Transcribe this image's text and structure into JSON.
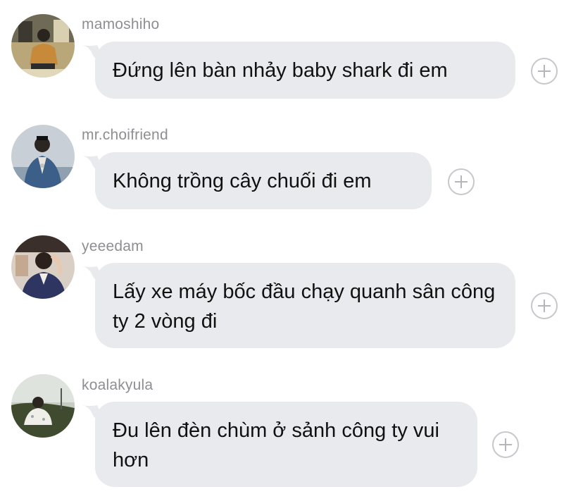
{
  "messages": [
    {
      "username": "mamoshiho",
      "text": "Đứng lên bàn nhảy baby shark đi em",
      "avatar_icon": "user-avatar",
      "add_icon": "plus-circle-icon"
    },
    {
      "username": "mr.choifriend",
      "text": "Không trồng cây chuối đi em",
      "avatar_icon": "user-avatar",
      "add_icon": "plus-circle-icon"
    },
    {
      "username": "yeeedam",
      "text": "Lấy xe máy bốc đầu chạy quanh sân công ty 2 vòng đi",
      "avatar_icon": "user-avatar",
      "add_icon": "plus-circle-icon"
    },
    {
      "username": "koalakyula",
      "text": "Đu lên đèn chùm ở sảnh công ty vui hơn",
      "avatar_icon": "user-avatar",
      "add_icon": "plus-circle-icon"
    }
  ],
  "colors": {
    "bubble": "#e9eaee",
    "username": "#8e8e93",
    "text": "#111111",
    "add_border": "#c7c7cc"
  }
}
